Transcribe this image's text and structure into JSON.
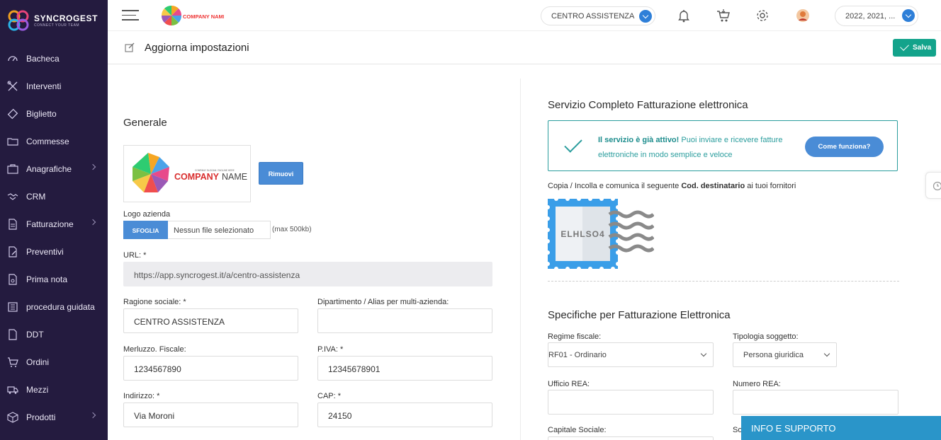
{
  "brand": {
    "name": "SYNCROGEST",
    "tagline": "CONNECT YOUR TEAM"
  },
  "sidebar": {
    "items": [
      {
        "label": "Bacheca",
        "icon": "dashboard-icon"
      },
      {
        "label": "Interventi",
        "icon": "tools-icon"
      },
      {
        "label": "Biglietto",
        "icon": "ticket-icon"
      },
      {
        "label": "Commesse",
        "icon": "folder-icon"
      },
      {
        "label": "Anagrafiche",
        "icon": "contacts-icon",
        "submenu": true
      },
      {
        "label": "CRM",
        "icon": "handshake-icon"
      },
      {
        "label": "Fatturazione",
        "icon": "invoice-icon",
        "submenu": true
      },
      {
        "label": "Preventivi",
        "icon": "quote-icon"
      },
      {
        "label": "Prima nota",
        "icon": "ledger-icon"
      },
      {
        "label": "procedura guidata",
        "icon": "wizard-icon"
      },
      {
        "label": "DDT",
        "icon": "ddt-icon"
      },
      {
        "label": "Ordini",
        "icon": "cart-icon"
      },
      {
        "label": "Mezzi",
        "icon": "truck-icon"
      },
      {
        "label": "Prodotti",
        "icon": "box-icon",
        "submenu": true
      }
    ]
  },
  "header": {
    "company_select": "CENTRO ASSISTENZA",
    "year_select": "2022, 2021, ...",
    "top_logo_text": "COMPANY NAME"
  },
  "page": {
    "title": "Aggiorna impostazioni",
    "save_label": "Salva"
  },
  "generale": {
    "title": "Generale",
    "logo_text_company": "COMPANY",
    "logo_text_name": "NAME",
    "logo_slogan": "COMPANY SLOGAN / TAGLINE HERE",
    "remove_label": "Rimuovi",
    "logo_label": "Logo azienda",
    "browse_label": "SFOGLIA",
    "no_file": "Nessun file selezionato",
    "max_hint": "(max 500kb)",
    "url_label": "URL: *",
    "url_value": "https://app.syncrogest.it/a/centro-assistenza",
    "ragione_label": "Ragione sociale: *",
    "ragione_value": "CENTRO ASSISTENZA",
    "dipartimento_label": "Dipartimento / Alias per multi-azienda:",
    "dipartimento_value": "",
    "cf_label": "Merluzzo. Fiscale:",
    "cf_value": "1234567890",
    "piva_label": "P.IVA: *",
    "piva_value": "12345678901",
    "indirizzo_label": "Indirizzo: *",
    "indirizzo_value": "Via Moroni",
    "cap_label": "CAP: *",
    "cap_value": "24150"
  },
  "fatturazione": {
    "title": "Servizio Completo Fatturazione elettronica",
    "active_bold": "Il servizio è già attivo!",
    "active_text": " Puoi inviare e ricevere fatture elettroniche in modo semplice e veloce",
    "how_label": "Come funziona?",
    "copy_prefix": "Copia / Incolla e comunica il seguente ",
    "copy_bold": "Cod. destinatario",
    "copy_suffix": " ai tuoi fornitori",
    "code": "ELHLSO4"
  },
  "specifiche": {
    "title": "Specifiche per Fatturazione Elettronica",
    "regime_label": "Regime fiscale:",
    "regime_value": "RF01 - Ordinario",
    "tipologia_label": "Tipologia soggetto:",
    "tipologia_value": "Persona giuridica",
    "ufficio_label": "Ufficio REA:",
    "numero_label": "Numero REA:",
    "capitale_label": "Capitale Sociale:",
    "so_label": "So"
  },
  "support_label": "INFO E SUPPORTO",
  "colors": {
    "sidebar": "#241b3f",
    "accent": "#4a8cd6",
    "save": "#13a38b",
    "teal": "#2a9d9d",
    "support": "#2a95c9"
  }
}
